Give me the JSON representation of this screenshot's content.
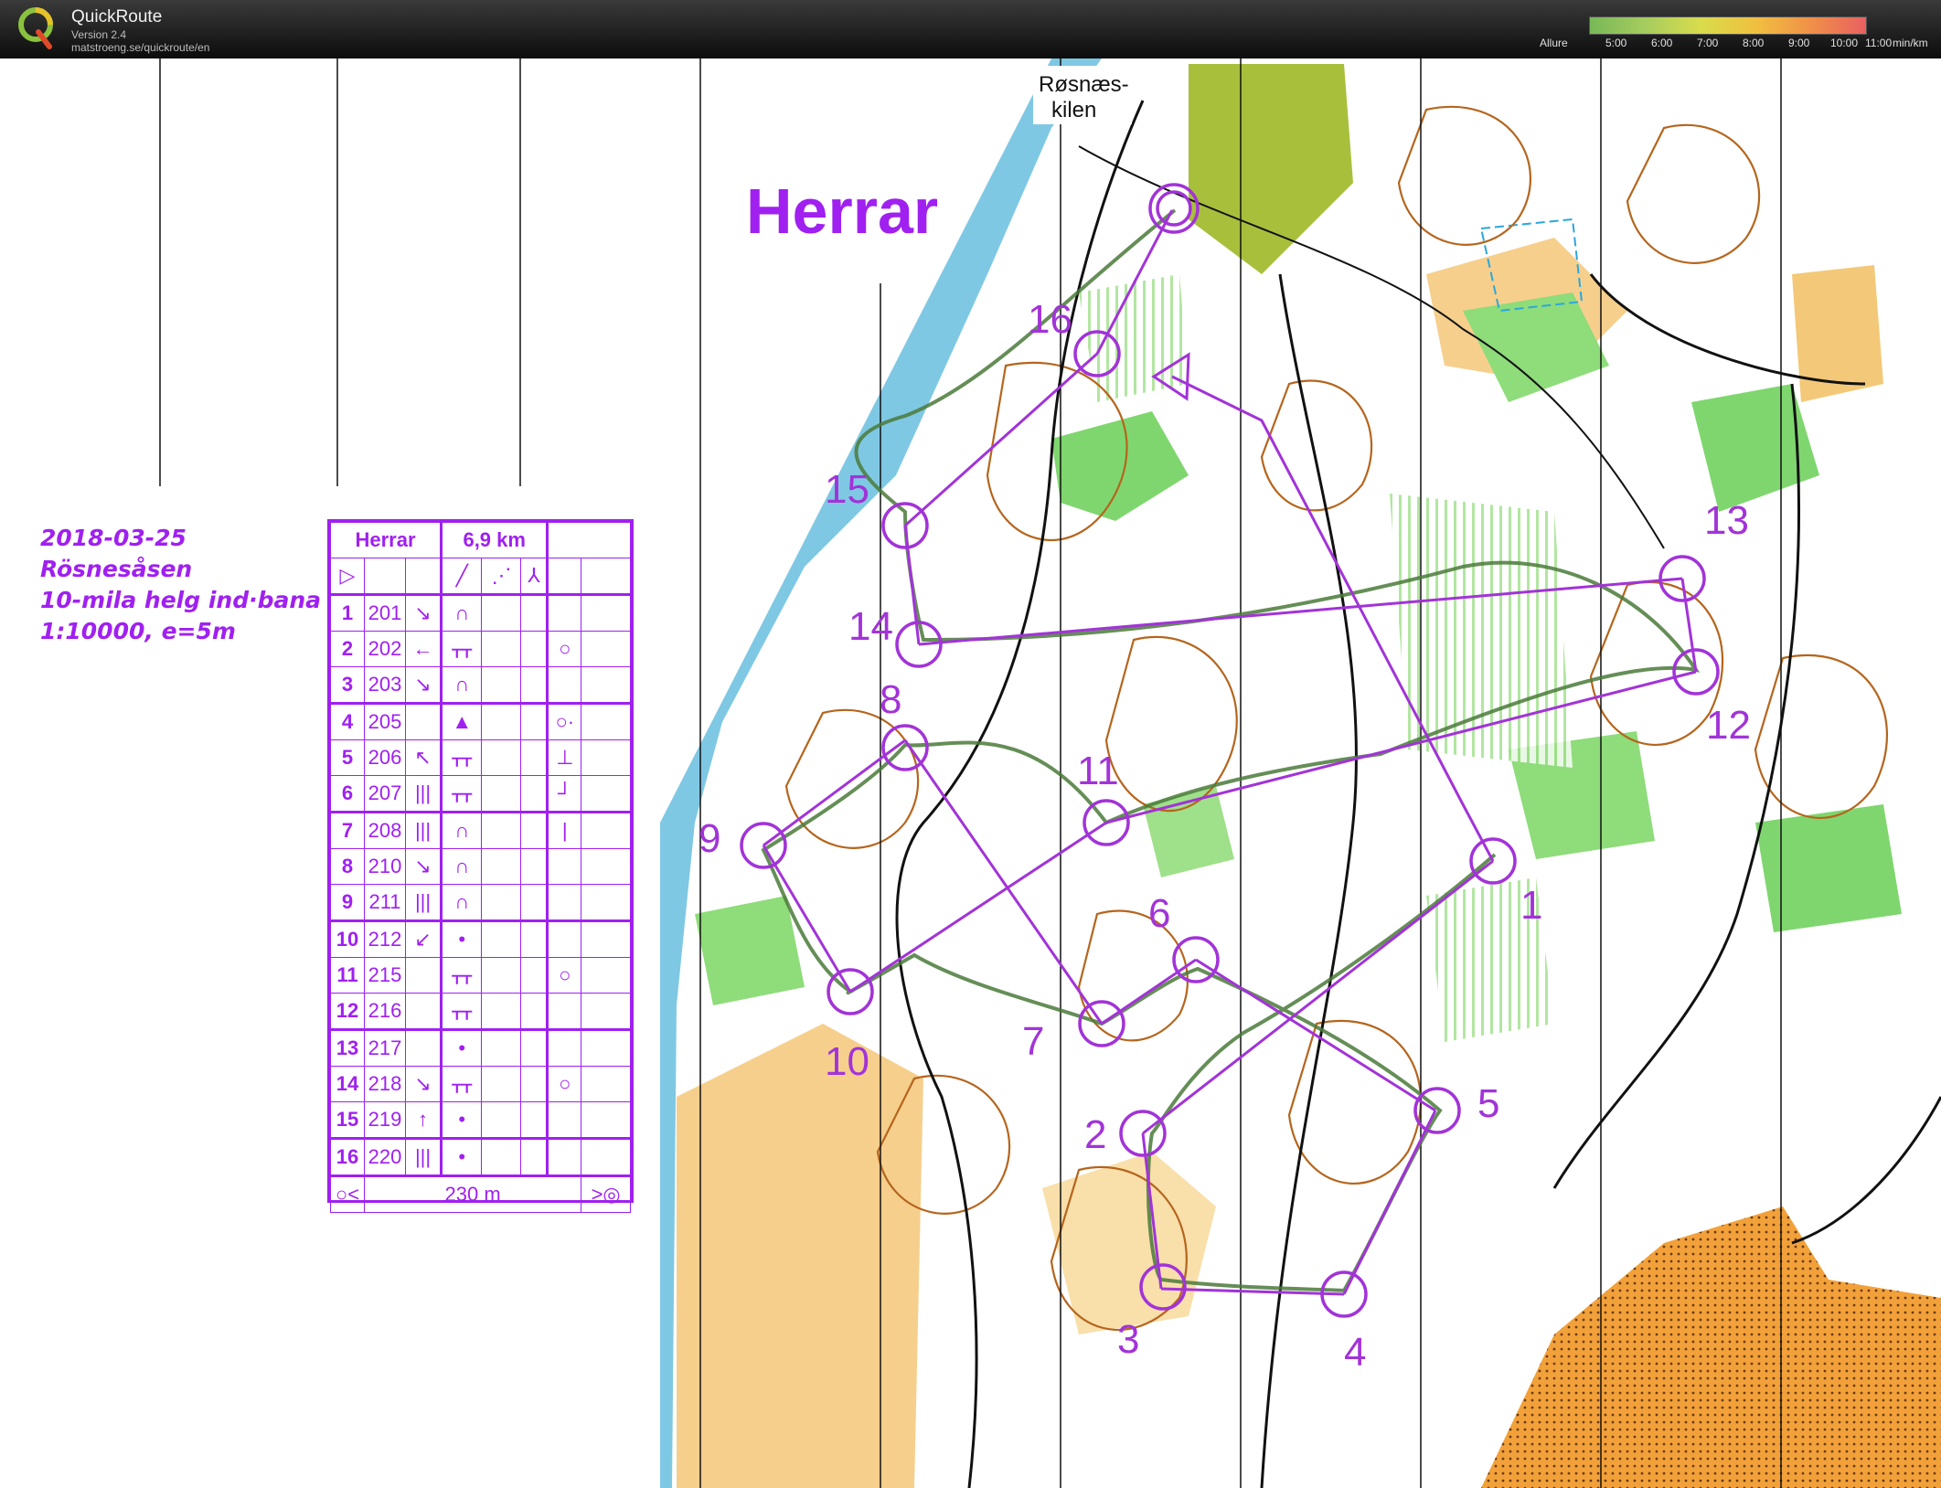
{
  "app": {
    "title": "QuickRoute",
    "version": "Version 2.4",
    "url": "matstroeng.se/quickroute/en"
  },
  "pace_scale": {
    "label": "Allure",
    "ticks": [
      "5:00",
      "6:00",
      "7:00",
      "8:00",
      "9:00",
      "10:00",
      "11:00"
    ],
    "unit": "min/km"
  },
  "map": {
    "title": "Herrar",
    "place_name_line1": "Røsnæs-",
    "place_name_line2": "kilen",
    "controls": [
      "1",
      "2",
      "3",
      "4",
      "5",
      "6",
      "7",
      "8",
      "9",
      "10",
      "11",
      "12",
      "13",
      "14",
      "15",
      "16"
    ]
  },
  "notes": {
    "date": "2018-03-25",
    "area": "Rösnesåsen",
    "event": "10-mila helg ind·bana",
    "scale": "1:10000,  e=5m"
  },
  "control_descriptions": {
    "course": "Herrar",
    "length": "6,9 km",
    "finish_distance": "230 m",
    "rows": [
      {
        "n": "1",
        "code": "201",
        "dir": "↘",
        "feature": "∩",
        "extra": ""
      },
      {
        "n": "2",
        "code": "202",
        "dir": "←",
        "feature": "ᚁᚁ",
        "extra": "○"
      },
      {
        "n": "3",
        "code": "203",
        "dir": "↘",
        "feature": "∩",
        "extra": ""
      },
      {
        "n": "4",
        "code": "205",
        "dir": "",
        "feature": "▲",
        "extra": "○·"
      },
      {
        "n": "5",
        "code": "206",
        "dir": "↖",
        "feature": "ᚁᚁ",
        "extra": "⊥"
      },
      {
        "n": "6",
        "code": "207",
        "dir": "|||",
        "feature": "ᚁᚁ",
        "extra": "┘"
      },
      {
        "n": "7",
        "code": "208",
        "dir": "|||",
        "feature": "∩",
        "extra": "|"
      },
      {
        "n": "8",
        "code": "210",
        "dir": "↘",
        "feature": "∩",
        "extra": ""
      },
      {
        "n": "9",
        "code": "211",
        "dir": "|||",
        "feature": "∩",
        "extra": ""
      },
      {
        "n": "10",
        "code": "212",
        "dir": "↙",
        "feature": "•",
        "extra": ""
      },
      {
        "n": "11",
        "code": "215",
        "dir": "",
        "feature": "ᚁᚁ",
        "extra": "○"
      },
      {
        "n": "12",
        "code": "216",
        "dir": "",
        "feature": "ᚁᚁ",
        "extra": ""
      },
      {
        "n": "13",
        "code": "217",
        "dir": "",
        "feature": "•",
        "extra": ""
      },
      {
        "n": "14",
        "code": "218",
        "dir": "↘",
        "feature": "ᚁᚁ",
        "extra": "○"
      },
      {
        "n": "15",
        "code": "219",
        "dir": "↑",
        "feature": "•",
        "extra": ""
      },
      {
        "n": "16",
        "code": "220",
        "dir": "|||",
        "feature": "•",
        "extra": ""
      }
    ]
  },
  "colors": {
    "course": "#a233d8",
    "water": "#7fc8e4",
    "open_land": "#f4c77a",
    "forest_green": "#7fd66f",
    "contour": "#b5651d",
    "route": "#4a7a3a"
  }
}
